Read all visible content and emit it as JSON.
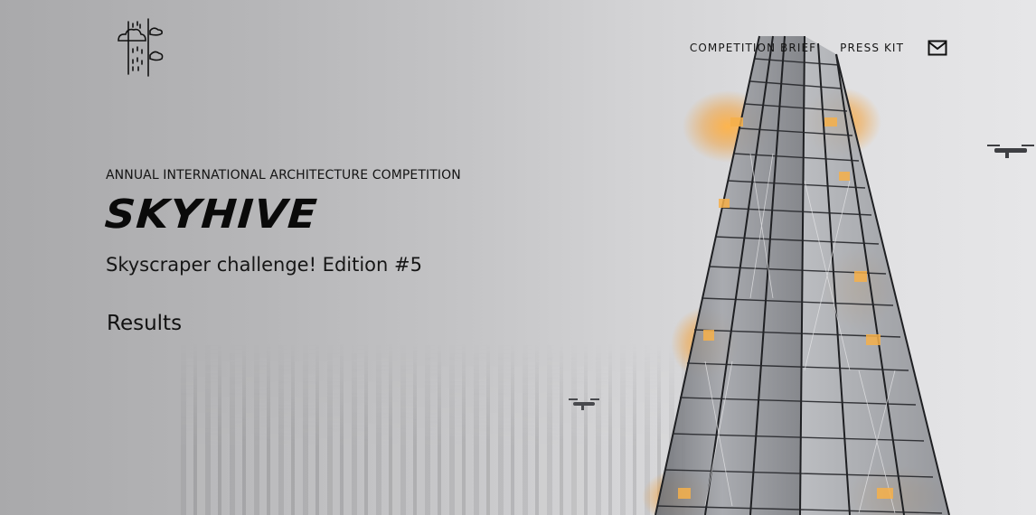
{
  "header": {
    "logo_icon": "skyhive-logo-icon",
    "nav": {
      "competition_brief": "COMPETITION BRIEF",
      "press_kit": "PRESS KIT",
      "contact_icon": "envelope-icon"
    }
  },
  "hero": {
    "kicker": "ANNUAL INTERNATIONAL ARCHITECTURE COMPETITION",
    "title": "SKYHIVE",
    "subtitle": "Skyscraper challenge! Edition #5",
    "results_link": "Results",
    "background_image": "glass-tower-with-drones",
    "colors": {
      "text": "#111111",
      "glow": "#f4a63a"
    }
  }
}
